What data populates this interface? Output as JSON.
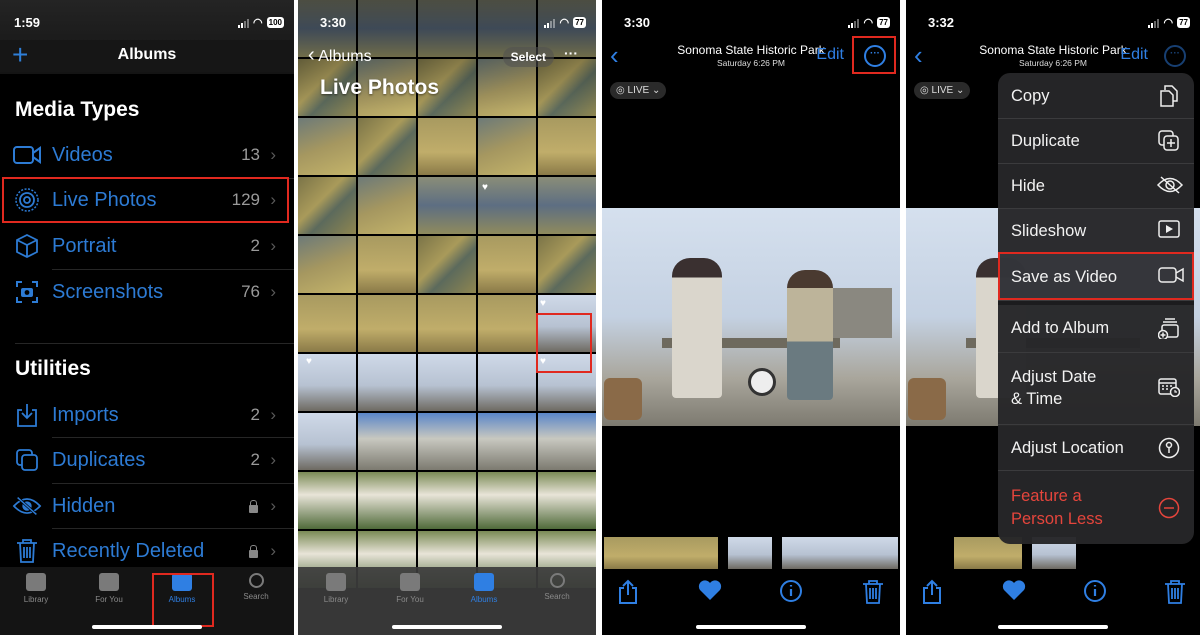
{
  "panel1": {
    "status": {
      "time": "1:59",
      "battery": "100"
    },
    "nav": {
      "title": "Albums",
      "add_icon": "plus-icon"
    },
    "media_types": {
      "heading": "Media Types",
      "items": [
        {
          "label": "Videos",
          "count": "13",
          "icon": "video-camera-icon"
        },
        {
          "label": "Live Photos",
          "count": "129",
          "icon": "live-photo-icon",
          "highlighted": true
        },
        {
          "label": "Portrait",
          "count": "2",
          "icon": "cube-icon"
        },
        {
          "label": "Screenshots",
          "count": "76",
          "icon": "screenshot-icon"
        }
      ]
    },
    "utilities": {
      "heading": "Utilities",
      "items": [
        {
          "label": "Imports",
          "count": "2",
          "icon": "import-icon"
        },
        {
          "label": "Duplicates",
          "count": "2",
          "icon": "duplicates-icon"
        },
        {
          "label": "Hidden",
          "count": "",
          "locked": true,
          "icon": "eye-slash-icon"
        },
        {
          "label": "Recently Deleted",
          "count": "",
          "locked": true,
          "icon": "trash-icon"
        }
      ]
    },
    "tabs": [
      {
        "label": "Library"
      },
      {
        "label": "For You"
      },
      {
        "label": "Albums",
        "active": true
      },
      {
        "label": "Search"
      }
    ]
  },
  "panel2": {
    "status": {
      "time": "3:30",
      "battery": "77"
    },
    "back_label": "Albums",
    "select_label": "Select",
    "more_label": "···",
    "title": "Live Photos",
    "tabs": [
      {
        "label": "Library"
      },
      {
        "label": "For You"
      },
      {
        "label": "Albums",
        "active": true
      },
      {
        "label": "Search"
      }
    ]
  },
  "panel3": {
    "status": {
      "time": "3:30",
      "battery": "77"
    },
    "title": "Sonoma State Historic Park",
    "subtitle": "Saturday  6:26 PM",
    "edit_label": "Edit",
    "live_label": "LIVE",
    "more_icon": "ellipsis-circle-icon"
  },
  "panel4": {
    "status": {
      "time": "3:32",
      "battery": "77"
    },
    "title": "Sonoma State Historic Park",
    "subtitle": "Saturday  6:26 PM",
    "edit_label": "Edit",
    "live_label": "LIVE",
    "menu": [
      {
        "label": "Copy",
        "icon": "copy-icon"
      },
      {
        "label": "Duplicate",
        "icon": "duplicate-icon"
      },
      {
        "label": "Hide",
        "icon": "eye-slash-icon"
      },
      {
        "label": "Slideshow",
        "icon": "play-icon"
      },
      {
        "label": "Save as Video",
        "icon": "video-camera-icon",
        "highlighted": true
      },
      {
        "label": "Add to Album",
        "icon": "add-to-album-icon"
      },
      {
        "label": "Adjust Date\n& Time",
        "line1": "Adjust Date",
        "line2": "& Time",
        "icon": "calendar-clock-icon"
      },
      {
        "label": "Adjust Location",
        "icon": "location-info-icon"
      },
      {
        "label": "Feature a Person Less",
        "line1": "Feature a",
        "line2": "Person Less",
        "icon": "minus-circle-icon",
        "destructive": true
      }
    ]
  },
  "colors": {
    "accent": "#2f7fe3",
    "highlight": "#e0291f",
    "destructive": "#e5453c"
  }
}
